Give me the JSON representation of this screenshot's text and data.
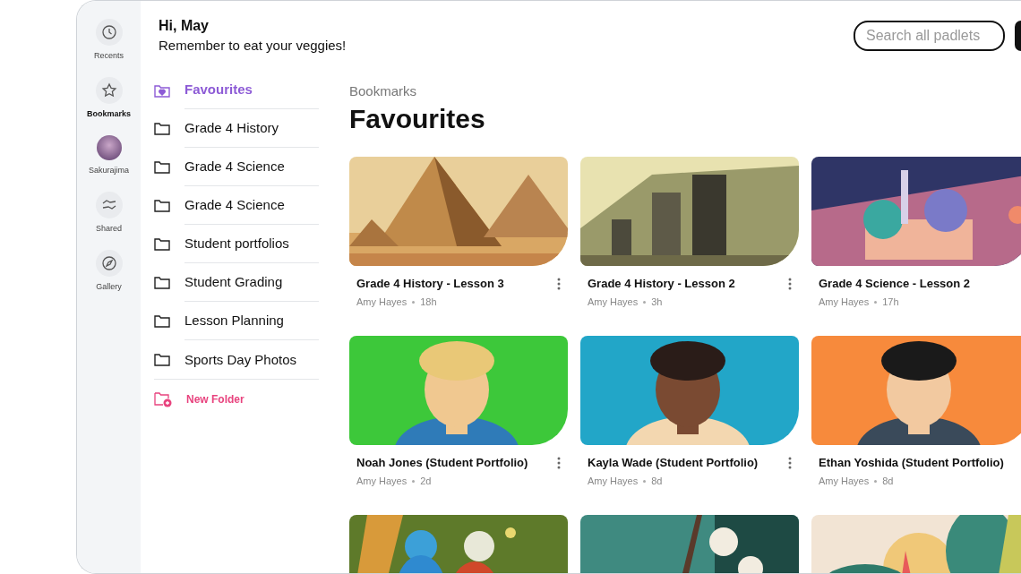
{
  "rail": [
    {
      "kind": "icon",
      "label": "Recents",
      "selected": false
    },
    {
      "kind": "icon",
      "label": "Bookmarks",
      "selected": true
    },
    {
      "kind": "avatar",
      "label": "Sakurajima",
      "selected": false
    },
    {
      "kind": "icon",
      "label": "Shared",
      "selected": false
    },
    {
      "kind": "icon",
      "label": "Gallery",
      "selected": false
    }
  ],
  "greeting": {
    "title": "Hi, May",
    "message": "Remember to eat your veggies!"
  },
  "search": {
    "placeholder": "Search all padlets"
  },
  "folders": [
    {
      "kind": "favourites",
      "label": "Favourites",
      "selected": true
    },
    {
      "kind": "folder",
      "label": "Grade 4 History",
      "selected": false
    },
    {
      "kind": "folder",
      "label": "Grade 4 Science",
      "selected": false
    },
    {
      "kind": "folder",
      "label": "Grade 4 Science",
      "selected": false
    },
    {
      "kind": "folder",
      "label": "Student portfolios",
      "selected": false
    },
    {
      "kind": "folder",
      "label": "Student Grading",
      "selected": false
    },
    {
      "kind": "folder",
      "label": "Lesson Planning",
      "selected": false
    },
    {
      "kind": "folder",
      "label": "Sports Day Photos",
      "selected": false
    },
    {
      "kind": "new",
      "label": "New Folder",
      "selected": false
    }
  ],
  "breadcrumb": "Bookmarks",
  "heading": "Favourites",
  "cards": [
    {
      "kind": "card",
      "title": "Grade 4 History - Lesson 3",
      "author": "Amy Hayes",
      "age": "18h",
      "menu": true
    },
    {
      "kind": "card",
      "title": "Grade 4 History - Lesson 2",
      "author": "Amy Hayes",
      "age": "3h",
      "menu": true
    },
    {
      "kind": "card",
      "title": "Grade 4 Science - Lesson 2",
      "author": "Amy Hayes",
      "age": "17h",
      "menu": false
    },
    {
      "kind": "card",
      "title": "Noah Jones (Student Portfolio)",
      "author": "Amy Hayes",
      "age": "2d",
      "menu": true
    },
    {
      "kind": "card",
      "title": "Kayla Wade (Student Portfolio)",
      "author": "Amy Hayes",
      "age": "8d",
      "menu": true
    },
    {
      "kind": "card",
      "title": "Ethan Yoshida (Student Portfolio)",
      "author": "Amy Hayes",
      "age": "8d",
      "menu": false
    },
    {
      "kind": "picture"
    },
    {
      "kind": "picture"
    },
    {
      "kind": "picture"
    }
  ]
}
